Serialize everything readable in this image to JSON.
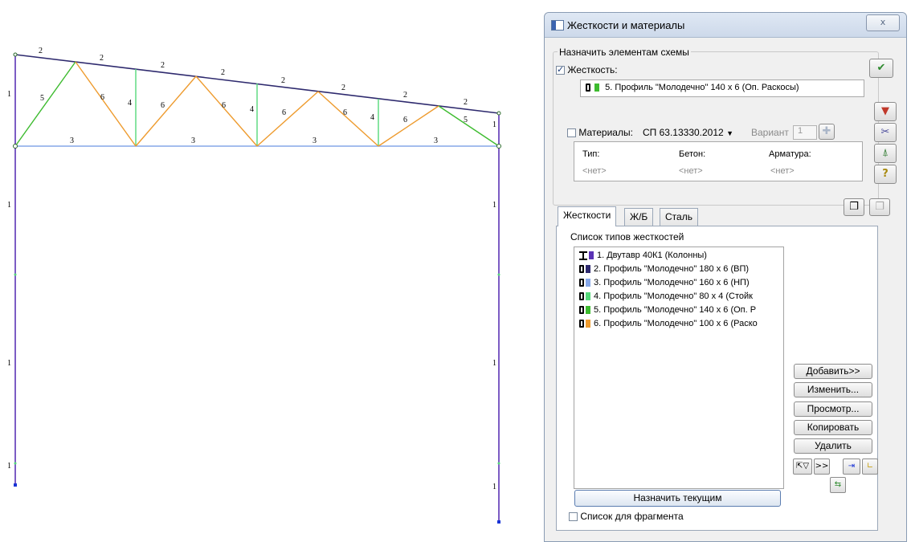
{
  "frame": {
    "labels": {
      "top_chord": "2",
      "bottom_chord": "3",
      "post": "4",
      "support_brace": "5",
      "diagonal": "6",
      "column": "1"
    },
    "colors": {
      "column": "#5b33b5",
      "top_chord": "#2e2a6e",
      "bottom_chord": "#86a7e8",
      "post": "#55d87a",
      "support_brace": "#3dbb2f",
      "diagonal": "#ee9b2e"
    }
  },
  "dialog": {
    "title": "Жесткости и материалы",
    "close_label": "ⅹ",
    "group_label": "Назначить элементам схемы",
    "stiffness_label": "Жесткость:",
    "stiffness_checked": true,
    "current_stiffness": "5. Профиль \"Молодечно\" 140 x 6 (Оп. Раскосы)",
    "current_color": "#3dbb2f",
    "materials_label": "Материалы:",
    "materials_checked": false,
    "materials_norm": "СП 63.13330.2012",
    "variant_label": "Вариант",
    "variant_value": "1",
    "grid": {
      "headers": [
        "Тип:",
        "Бетон:",
        "Арматура:"
      ],
      "values": [
        "<нет>",
        "<нет>",
        "<нет>"
      ]
    },
    "tabs": [
      "Жесткости",
      "Ж/Б",
      "Сталь"
    ],
    "active_tab": "Жесткости",
    "list_title": "Список типов жесткостей",
    "list_items": [
      {
        "text": "1. Двутавр 40К1 (Колонны)",
        "icon": "i-beam-icon",
        "color": "#5b33b5"
      },
      {
        "text": "2. Профиль \"Молодечно\" 180 x 6 (ВП)",
        "icon": "rect-profile-icon",
        "color": "#2e2a6e"
      },
      {
        "text": "3. Профиль \"Молодечно\" 160 x 6 (НП)",
        "icon": "rect-profile-icon",
        "color": "#86a7e8"
      },
      {
        "text": "4. Профиль \"Молодечно\" 80 x 4 (Стойк",
        "icon": "rect-profile-icon",
        "color": "#55d87a"
      },
      {
        "text": "5. Профиль \"Молодечно\" 140 x 6 (Оп. Р",
        "icon": "rect-profile-icon",
        "color": "#3dbb2f"
      },
      {
        "text": "6. Профиль \"Молодечно\" 100 x 6 (Раско",
        "icon": "rect-profile-icon",
        "color": "#ee9b2e"
      }
    ],
    "buttons": {
      "add": "Добавить>>",
      "edit": "Изменить...",
      "view": "Просмотр...",
      "copy": "Копировать",
      "delete": "Удалить",
      "more": ">>",
      "assign": "Назначить текущим"
    },
    "fragment_label": "Список для фрагмента",
    "fragment_checked": false
  }
}
